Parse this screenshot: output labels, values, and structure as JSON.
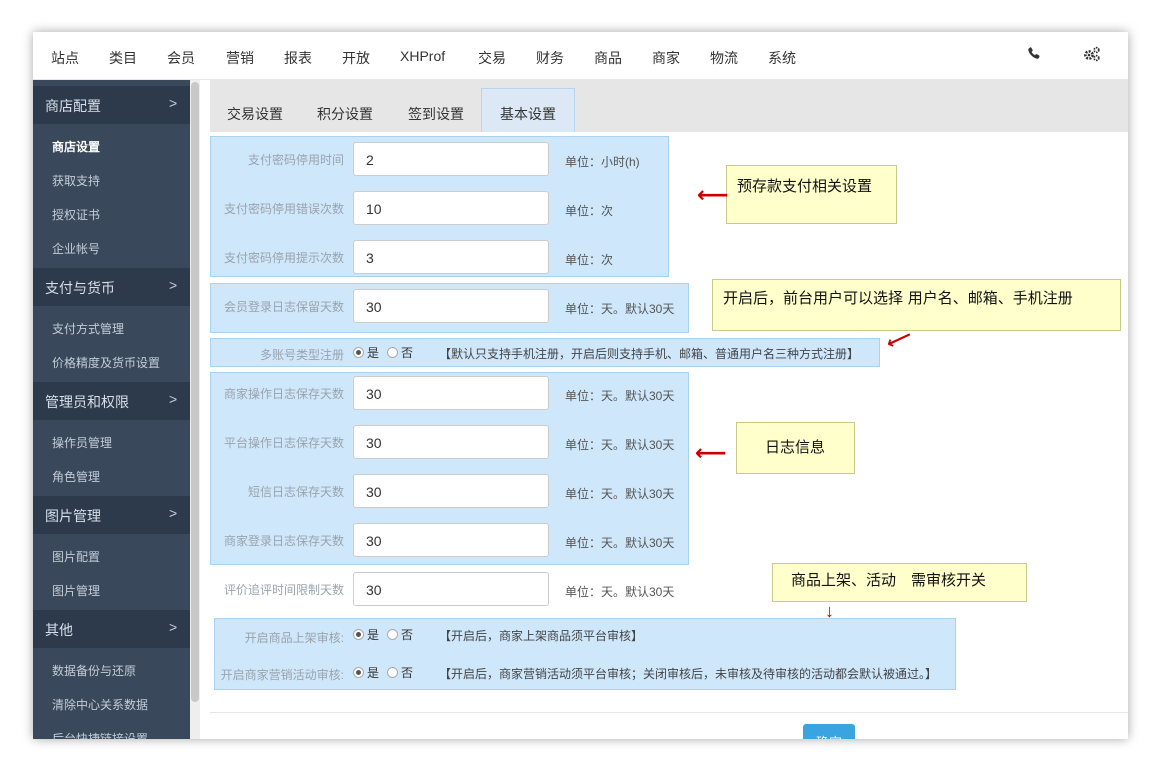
{
  "topnav": {
    "items": [
      "站点",
      "类目",
      "会员",
      "营销",
      "报表",
      "开放",
      "XHProf",
      "交易",
      "财务",
      "商品",
      "商家",
      "物流",
      "系统"
    ],
    "phone_icon": "phone-icon",
    "settings_icon": "gears-icon"
  },
  "sidebar": {
    "groups": [
      {
        "label": "商店配置",
        "items": [
          "商店设置",
          "获取支持",
          "授权证书",
          "企业帐号"
        ]
      },
      {
        "label": "支付与货币",
        "items": [
          "支付方式管理",
          "价格精度及货币设置"
        ]
      },
      {
        "label": "管理员和权限",
        "items": [
          "操作员管理",
          "角色管理"
        ]
      },
      {
        "label": "图片管理",
        "items": [
          "图片配置",
          "图片管理"
        ]
      },
      {
        "label": "其他",
        "items": [
          "数据备份与还原",
          "清除中心关系数据",
          "后台快捷链接设置"
        ]
      }
    ],
    "chevron": ">",
    "active_item": "商店设置"
  },
  "tabs": [
    "交易设置",
    "积分设置",
    "签到设置",
    "基本设置"
  ],
  "active_tab": "基本设置",
  "form": {
    "rows": [
      {
        "label": "支付密码停用时间",
        "value": "2",
        "unit": "单位：小时(h)"
      },
      {
        "label": "支付密码停用错误次数",
        "value": "10",
        "unit": "单位：次"
      },
      {
        "label": "支付密码停用提示次数",
        "value": "3",
        "unit": "单位：次"
      },
      {
        "label": "会员登录日志保留天数",
        "value": "30",
        "unit": "单位：天。默认30天"
      },
      {
        "label": "商家操作日志保存天数",
        "value": "30",
        "unit": "单位：天。默认30天"
      },
      {
        "label": "平台操作日志保存天数",
        "value": "30",
        "unit": "单位：天。默认30天"
      },
      {
        "label": "短信日志保存天数",
        "value": "30",
        "unit": "单位：天。默认30天"
      },
      {
        "label": "商家登录日志保存天数",
        "value": "30",
        "unit": "单位：天。默认30天"
      },
      {
        "label": "评价追评时间限制天数",
        "value": "30",
        "unit": "单位：天。默认30天"
      }
    ],
    "multi_account": {
      "label": "多账号类型注册",
      "yes": "是",
      "no": "否",
      "note": "【默认只支持手机注册，开启后则支持手机、邮箱、普通用户名三种方式注册】"
    },
    "audit_goods": {
      "label": "开启商品上架审核:",
      "yes": "是",
      "no": "否",
      "note": "【开启后，商家上架商品须平台审核】"
    },
    "audit_activity": {
      "label": "开启商家营销活动审核:",
      "yes": "是",
      "no": "否",
      "note": "【开启后，商家营销活动须平台审核；关闭审核后，未审核及待审核的活动都会默认被通过。】"
    },
    "submit_label": "确定"
  },
  "callouts": {
    "payment": "预存款支付相关设置",
    "register": "开启后，前台用户可以选择 用户名、邮箱、手机注册",
    "logs": "日志信息",
    "audit": "商品上架、活动　需审核开关"
  }
}
